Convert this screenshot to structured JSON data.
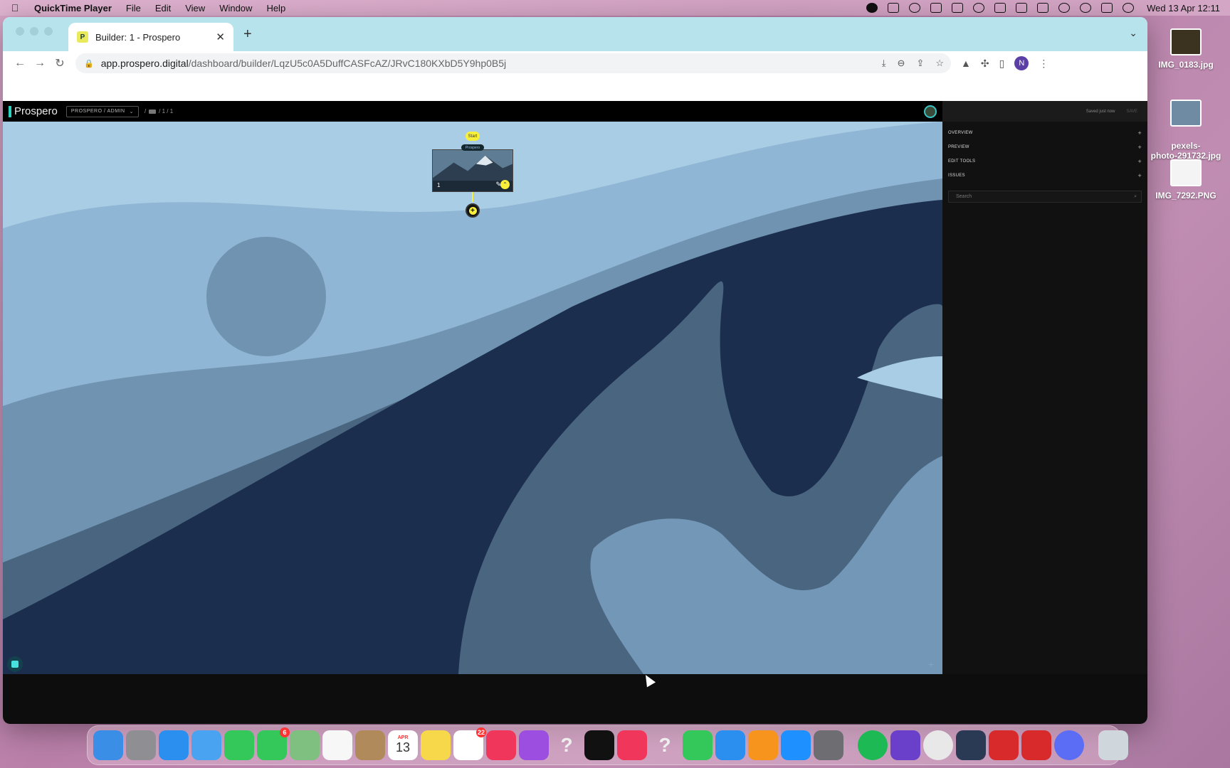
{
  "menubar": {
    "app_name": "QuickTime Player",
    "items": [
      "File",
      "Edit",
      "View",
      "Window",
      "Help"
    ],
    "clock": "Wed 13 Apr  12:11"
  },
  "browser": {
    "tab_title": "Builder: 1 - Prospero",
    "url_host": "app.prospero.digital",
    "url_path": "/dashboard/builder/LqzU5c0A5DuffCASFcAZ/JRvC180KXbD5Y9hp0B5j",
    "profile_initial": "N"
  },
  "app": {
    "logo": "Prospero",
    "org_select": "PROSPERO / ADMIN",
    "crumbs_page": "/ 1 / 1",
    "start_label": "Start",
    "node_tag": "Prospero",
    "node_number": "1"
  },
  "panel": {
    "saved_status": "Saved just now",
    "save_button": "SAVE",
    "sections": [
      "OVERVIEW",
      "PREVIEW",
      "EDIT TOOLS",
      "ISSUES"
    ],
    "search_placeholder": "Search"
  },
  "desktop_files": [
    {
      "name": "IMG_0183.jpg",
      "color": "#3b3320"
    },
    {
      "name": "pexels-\nphoto-291732.jpg",
      "color": "#6f8aa3"
    },
    {
      "name": "IMG_7292.PNG",
      "color": "#f4f4f4"
    }
  ],
  "dock": {
    "messages_badge": "6",
    "calendar_month": "APR",
    "calendar_day": "13",
    "reminders_badge": "22"
  },
  "colors": {
    "accent_yellow": "#f7ef3a",
    "teal": "#2cd3c0"
  }
}
